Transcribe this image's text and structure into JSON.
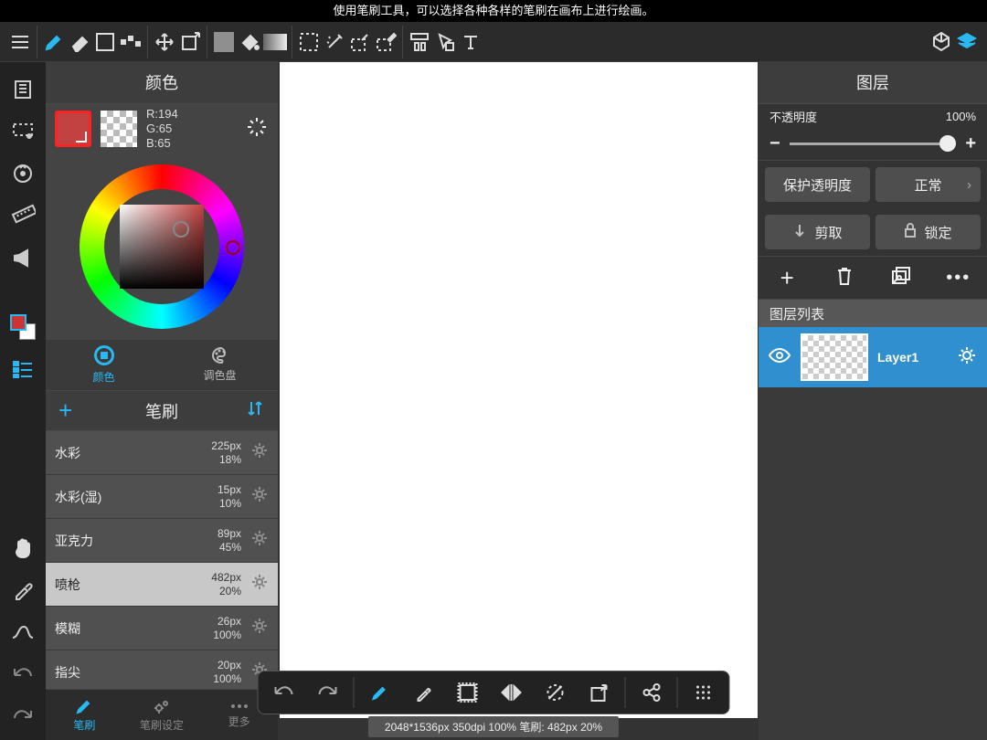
{
  "hint": "使用笔刷工具，可以选择各种各样的笔刷在画布上进行绘画。",
  "color_panel": {
    "title": "颜色",
    "rgb": {
      "r": "R:194",
      "g": "G:65",
      "b": "B:65"
    },
    "tabs": {
      "color": "颜色",
      "palette": "调色盘"
    }
  },
  "brush_panel": {
    "title": "笔刷",
    "items": [
      {
        "name": "水彩",
        "size": "225px",
        "opacity": "18%",
        "selected": false
      },
      {
        "name": "水彩(湿)",
        "size": "15px",
        "opacity": "10%",
        "selected": false
      },
      {
        "name": "亚克力",
        "size": "89px",
        "opacity": "45%",
        "selected": false
      },
      {
        "name": "喷枪",
        "size": "482px",
        "opacity": "20%",
        "selected": true
      },
      {
        "name": "模糊",
        "size": "26px",
        "opacity": "100%",
        "selected": false
      },
      {
        "name": "指尖",
        "size": "20px",
        "opacity": "100%",
        "selected": false
      }
    ],
    "bottom_tabs": {
      "brush": "笔刷",
      "settings": "笔刷设定",
      "more": "更多"
    }
  },
  "layers_panel": {
    "title": "图层",
    "opacity_label": "不透明度",
    "opacity_value": "100%",
    "protect": "保护透明度",
    "blend": "正常",
    "clip": "剪取",
    "lock": "锁定",
    "list_title": "图层列表",
    "layer1": "Layer1"
  },
  "status": "2048*1536px 350dpi 100% 笔刷: 482px 20%"
}
